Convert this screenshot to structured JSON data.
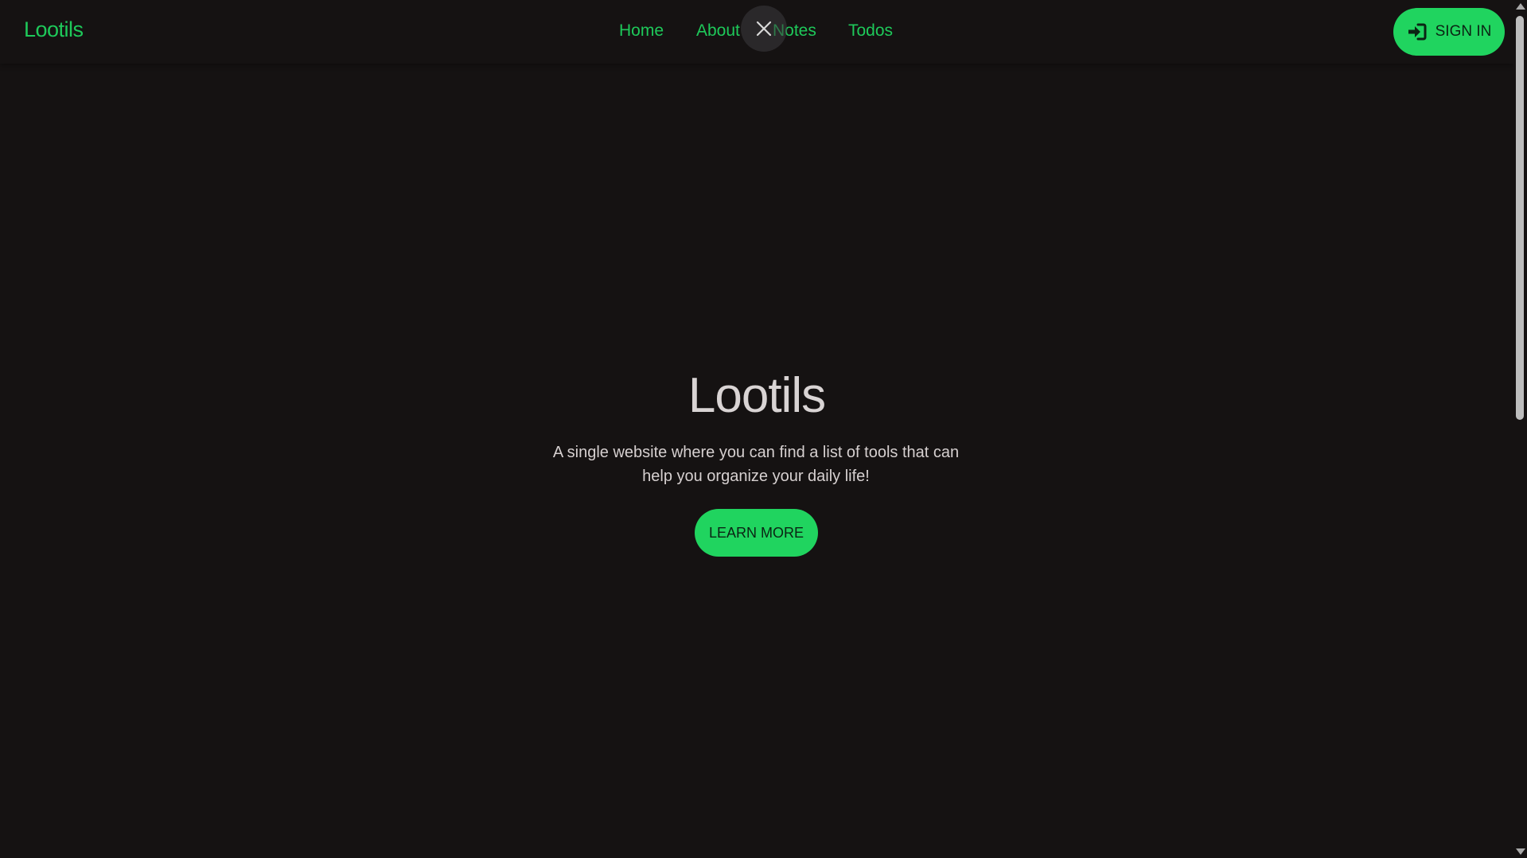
{
  "brand": "Lootils",
  "nav": {
    "links": [
      {
        "label": "Home"
      },
      {
        "label": "About"
      },
      {
        "label": "Notes"
      },
      {
        "label": "Todos"
      }
    ],
    "sign_in_label": "SIGN IN",
    "sign_in_icon": "sign-in-icon",
    "close_icon": "close-icon"
  },
  "hero": {
    "title": "Lootils",
    "subtitle": "A single website where you can find a list of tools that can help you organize your daily life!",
    "cta_label": "LEARN MORE"
  },
  "colors": {
    "background": "#151212",
    "accent": "#20d45f",
    "nav_text": "#1ec95a",
    "hero_text": "#d9d4d4"
  }
}
